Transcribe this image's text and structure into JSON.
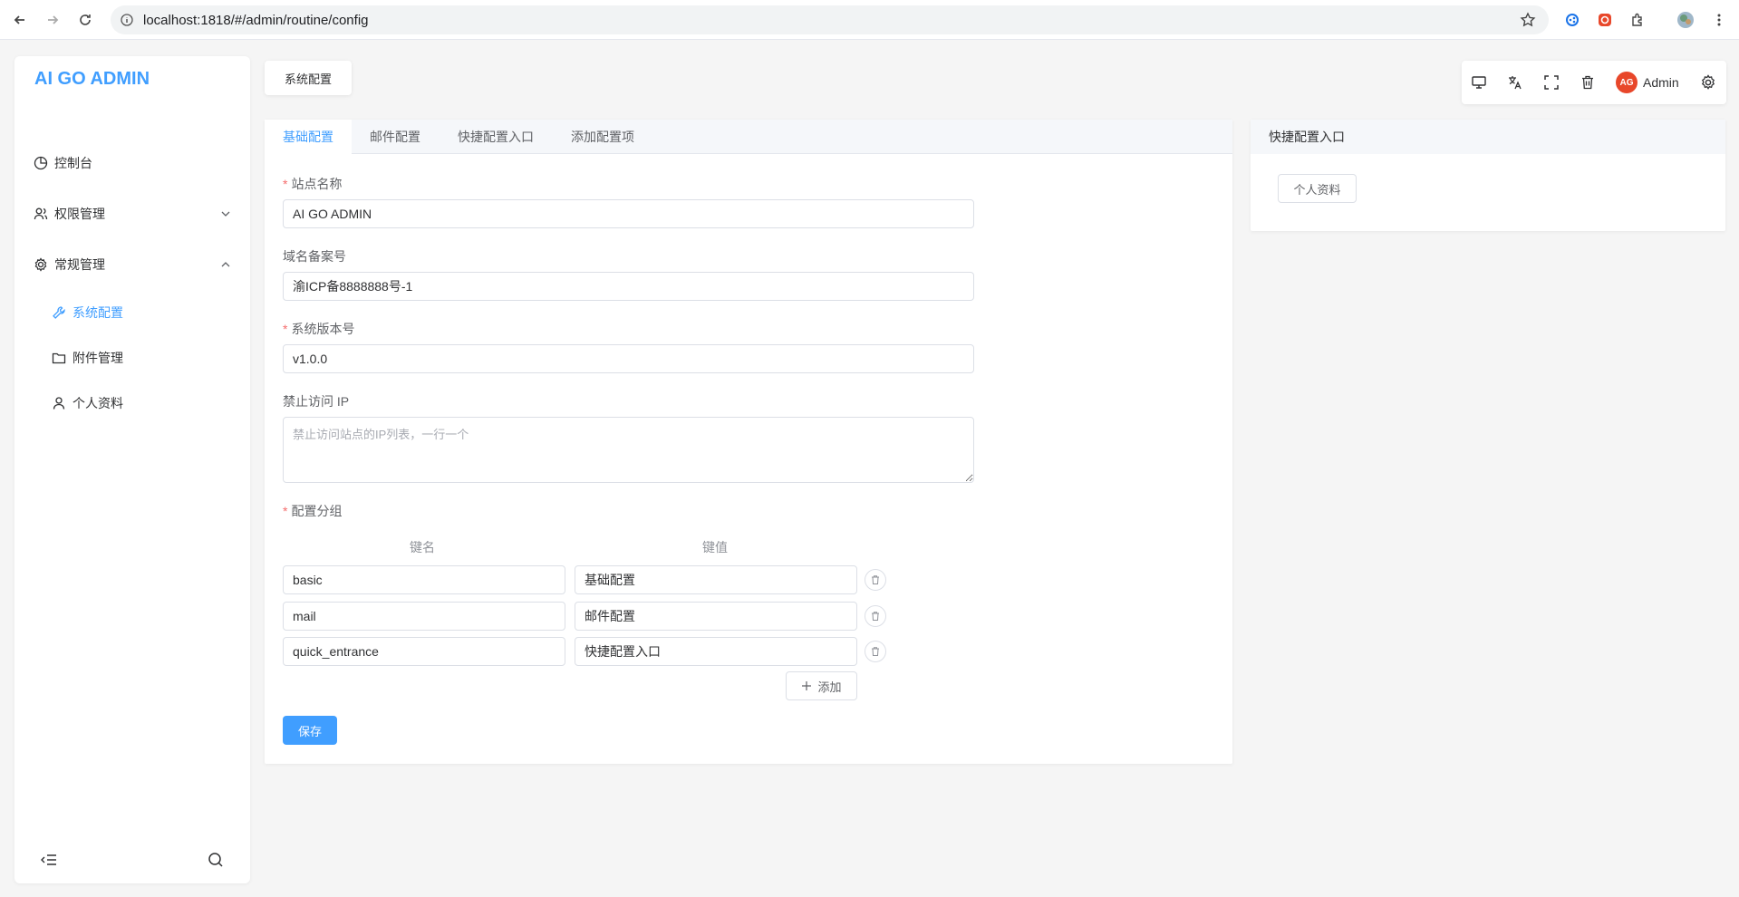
{
  "browser": {
    "url": "localhost:1818/#/admin/routine/config"
  },
  "sidebar": {
    "logo": "AI GO ADMIN",
    "items": [
      {
        "label": "控制台"
      },
      {
        "label": "权限管理"
      },
      {
        "label": "常规管理"
      }
    ],
    "subitems": [
      {
        "label": "系统配置"
      },
      {
        "label": "附件管理"
      },
      {
        "label": "个人资料"
      }
    ]
  },
  "tag_tab": {
    "label": "系统配置"
  },
  "toolbar": {
    "avatar_text": "AG",
    "user_name": "Admin"
  },
  "main": {
    "tabs": [
      {
        "label": "基础配置"
      },
      {
        "label": "邮件配置"
      },
      {
        "label": "快捷配置入口"
      },
      {
        "label": "添加配置项"
      }
    ],
    "form": {
      "site_name_label": "站点名称",
      "site_name_value": "AI GO ADMIN",
      "record_label": "域名备案号",
      "record_value": "渝ICP备8888888号-1",
      "version_label": "系统版本号",
      "version_value": "v1.0.0",
      "ban_ip_label": "禁止访问 IP",
      "ban_ip_placeholder": "禁止访问站点的IP列表，一行一个",
      "group_label": "配置分组",
      "key_header": "键名",
      "value_header": "键值",
      "groups": [
        {
          "key": "basic",
          "value": "基础配置"
        },
        {
          "key": "mail",
          "value": "邮件配置"
        },
        {
          "key": "quick_entrance",
          "value": "快捷配置入口"
        }
      ],
      "add_label": "添加",
      "save_label": "保存"
    }
  },
  "right_panel": {
    "title": "快捷配置入口",
    "button_label": "个人资料"
  },
  "colors": {
    "accent": "#409eff",
    "required": "#f56c6c",
    "avatar": "#e8472a"
  }
}
